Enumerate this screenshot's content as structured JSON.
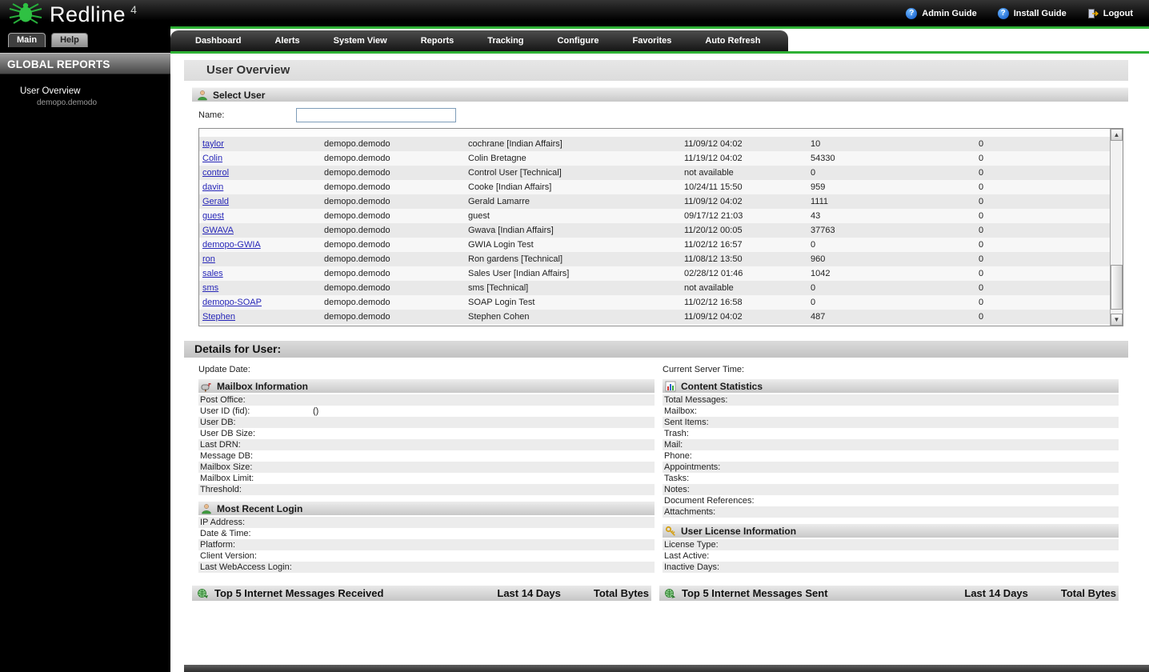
{
  "colors": {
    "accent_green": "#2eb135",
    "link_blue": "#2626b8",
    "topbar_black": "#000000"
  },
  "header": {
    "logo_text": "Redline",
    "logo_version": "4",
    "links": [
      {
        "label": "Admin Guide"
      },
      {
        "label": "Install Guide"
      },
      {
        "label": "Logout"
      }
    ]
  },
  "sidebar": {
    "tabs": [
      {
        "label": "Main"
      },
      {
        "label": "Help"
      }
    ],
    "title": "GLOBAL REPORTS",
    "report": "User Overview",
    "report_domain": "demopo.demodo"
  },
  "nav": {
    "items": [
      "Dashboard",
      "Alerts",
      "System View",
      "Reports",
      "Tracking",
      "Configure",
      "Favorites",
      "Auto Refresh"
    ]
  },
  "page": {
    "title": "User Overview",
    "select_user": {
      "title": "Select User",
      "name_label": "Name:",
      "name_value": "",
      "users": [
        [
          "taylor",
          "demopo.demodo",
          "cochrane [Indian Affairs]",
          "11/09/12 04:02",
          "10",
          "0"
        ],
        [
          "Colin",
          "demopo.demodo",
          "Colin Bretagne",
          "11/19/12 04:02",
          "54330",
          "0"
        ],
        [
          "control",
          "demopo.demodo",
          "Control User [Technical]",
          "not available",
          "0",
          "0"
        ],
        [
          "davin",
          "demopo.demodo",
          "Cooke [Indian Affairs]",
          "10/24/11 15:50",
          "959",
          "0"
        ],
        [
          "Gerald",
          "demopo.demodo",
          "Gerald Lamarre",
          "11/09/12 04:02",
          "1111",
          "0"
        ],
        [
          "guest",
          "demopo.demodo",
          "guest",
          "09/17/12 21:03",
          "43",
          "0"
        ],
        [
          "GWAVA",
          "demopo.demodo",
          "Gwava [Indian Affairs]",
          "11/20/12 00:05",
          "37763",
          "0"
        ],
        [
          "demopo-GWIA",
          "demopo.demodo",
          "GWIA Login Test",
          "11/02/12 16:57",
          "0",
          "0"
        ],
        [
          "ron",
          "demopo.demodo",
          "Ron gardens [Technical]",
          "11/08/12 13:50",
          "960",
          "0"
        ],
        [
          "sales",
          "demopo.demodo",
          "Sales User [Indian Affairs]",
          "02/28/12 01:46",
          "1042",
          "0"
        ],
        [
          "sms",
          "demopo.demodo",
          "sms [Technical]",
          "not available",
          "0",
          "0"
        ],
        [
          "demopo-SOAP",
          "demopo.demodo",
          "SOAP Login Test",
          "11/02/12 16:58",
          "0",
          "0"
        ],
        [
          "Stephen",
          "demopo.demodo",
          "Stephen Cohen",
          "11/09/12 04:02",
          "487",
          "0"
        ]
      ]
    },
    "details": {
      "title": "Details for User:",
      "update_date_label": "Update Date:",
      "server_time_label": "Current Server Time:",
      "mailbox_info": {
        "title": "Mailbox Information",
        "fields": [
          {
            "label": "Post Office:",
            "value": ""
          },
          {
            "label": "User ID (fid):",
            "value": "()"
          },
          {
            "label": "User DB:",
            "value": ""
          },
          {
            "label": "User DB Size:",
            "value": ""
          },
          {
            "label": "Last DRN:",
            "value": ""
          },
          {
            "label": "Message DB:",
            "value": ""
          },
          {
            "label": "Mailbox Size:",
            "value": ""
          },
          {
            "label": "Mailbox Limit:",
            "value": ""
          },
          {
            "label": "Threshold:",
            "value": ""
          }
        ]
      },
      "content_stats": {
        "title": "Content Statistics",
        "fields": [
          {
            "label": "Total Messages:",
            "value": ""
          },
          {
            "label": "Mailbox:",
            "value": ""
          },
          {
            "label": "Sent Items:",
            "value": ""
          },
          {
            "label": "Trash:",
            "value": ""
          },
          {
            "label": "Mail:",
            "value": ""
          },
          {
            "label": "Phone:",
            "value": ""
          },
          {
            "label": "Appointments:",
            "value": ""
          },
          {
            "label": "Tasks:",
            "value": ""
          },
          {
            "label": "Notes:",
            "value": ""
          },
          {
            "label": "Document References:",
            "value": ""
          },
          {
            "label": "Attachments:",
            "value": ""
          }
        ]
      },
      "recent_login": {
        "title": "Most Recent Login",
        "fields": [
          {
            "label": "IP Address:",
            "value": ""
          },
          {
            "label": "Date & Time:",
            "value": ""
          },
          {
            "label": "Platform:",
            "value": ""
          },
          {
            "label": "Client Version:",
            "value": ""
          },
          {
            "label": "Last WebAccess Login:",
            "value": ""
          }
        ]
      },
      "license_info": {
        "title": "User License Information",
        "fields": [
          {
            "label": "License Type:",
            "value": ""
          },
          {
            "label": "Last Active:",
            "value": ""
          },
          {
            "label": "Inactive Days:",
            "value": ""
          }
        ]
      }
    },
    "top5_received": {
      "title": "Top 5 Internet Messages Received",
      "col2": "Last 14 Days",
      "col3": "Total Bytes"
    },
    "top5_sent": {
      "title": "Top 5 Internet Messages Sent",
      "col2": "Last 14 Days",
      "col3": "Total Bytes"
    }
  }
}
